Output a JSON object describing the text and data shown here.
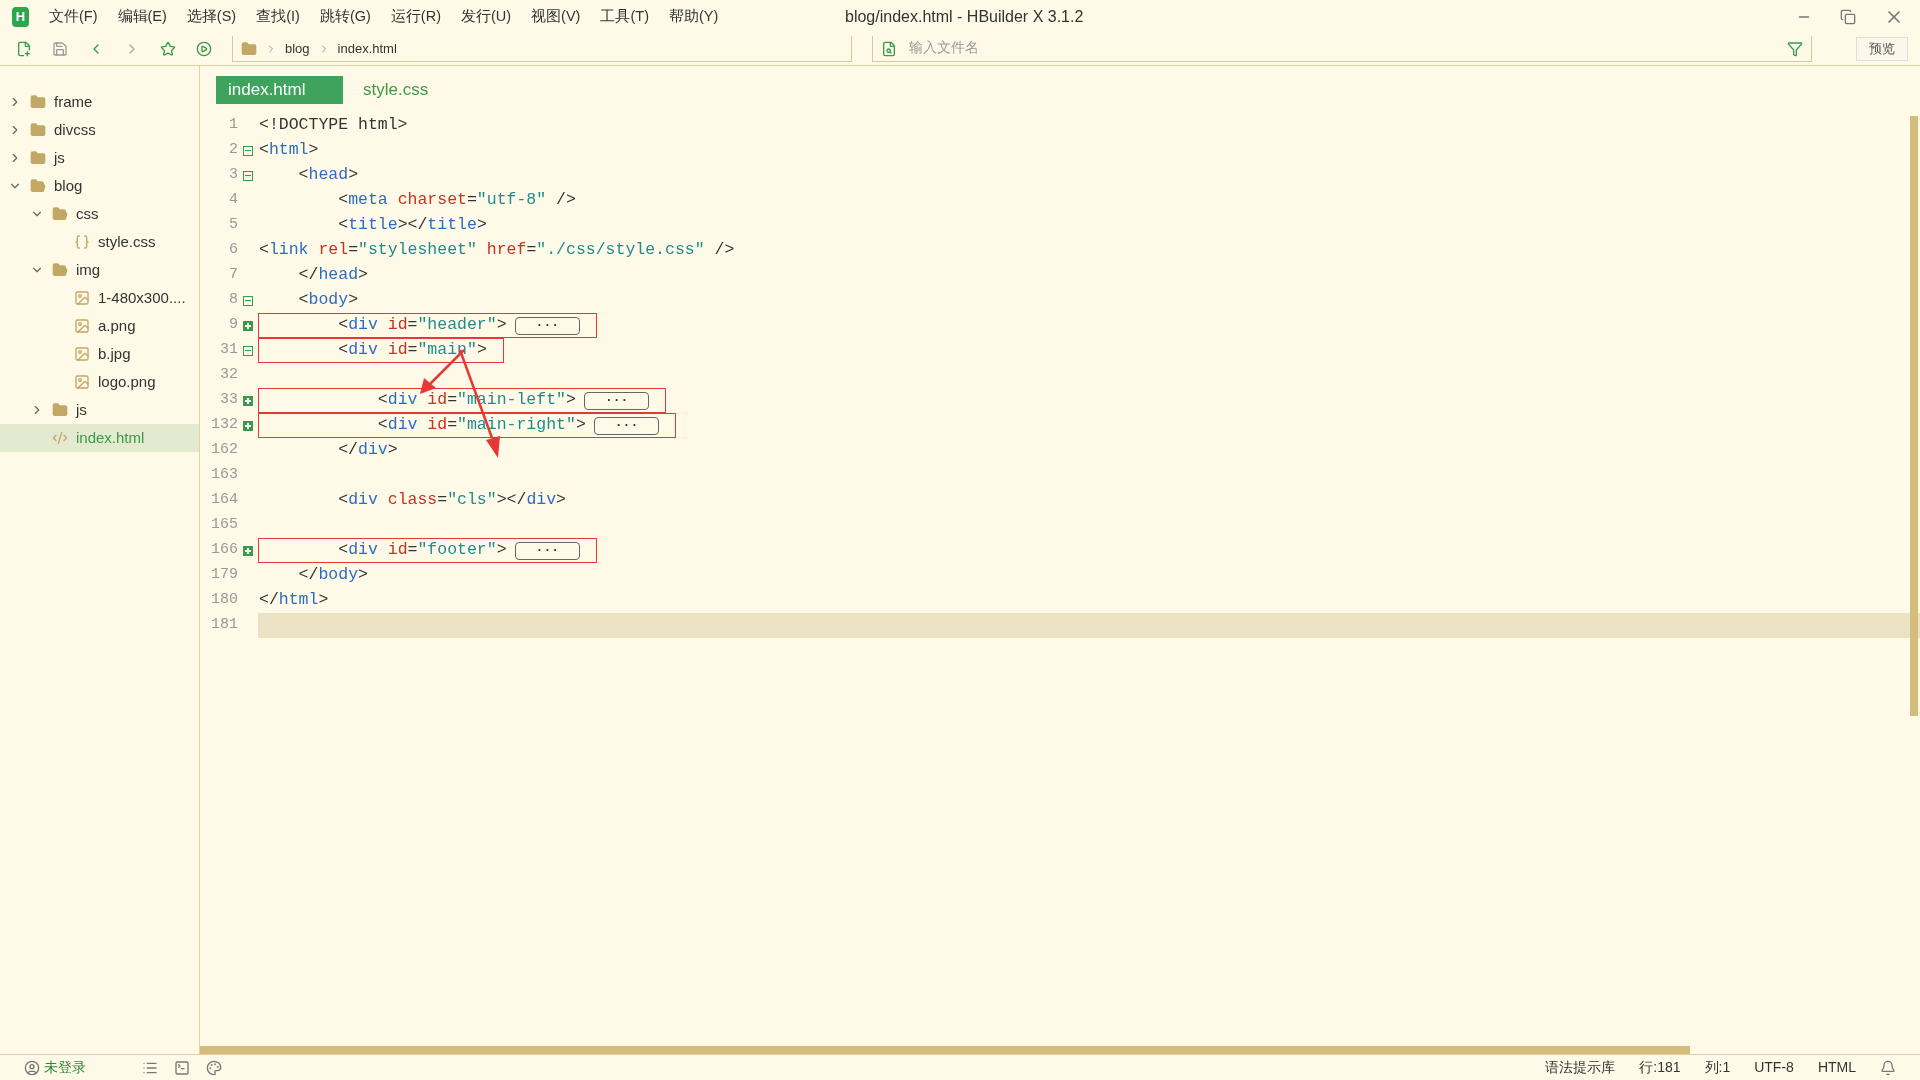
{
  "window": {
    "title": "blog/index.html - HBuilder X 3.1.2",
    "logo": "H"
  },
  "menu": [
    "文件(F)",
    "编辑(E)",
    "选择(S)",
    "查找(I)",
    "跳转(G)",
    "运行(R)",
    "发行(U)",
    "视图(V)",
    "工具(T)",
    "帮助(Y)"
  ],
  "toolbar": {
    "breadcrumb": [
      "blog",
      "index.html"
    ],
    "search": {
      "placeholder": "输入文件名"
    },
    "preview_button": "预览"
  },
  "sidebar": {
    "items": [
      {
        "name": "frame",
        "kind": "folder",
        "expanded": false,
        "selected": false
      },
      {
        "name": "divcss",
        "kind": "folder",
        "expanded": false,
        "selected": false
      },
      {
        "name": "js",
        "kind": "folder",
        "expanded": false,
        "selected": false
      },
      {
        "name": "blog",
        "kind": "folder",
        "expanded": true,
        "selected": false,
        "children": [
          {
            "name": "css",
            "kind": "folder",
            "expanded": true,
            "selected": false,
            "children": [
              {
                "name": "style.css",
                "kind": "css",
                "selected": false
              }
            ]
          },
          {
            "name": "img",
            "kind": "folder",
            "expanded": true,
            "selected": false,
            "children": [
              {
                "name": "1-480x300....",
                "kind": "image",
                "selected": false
              },
              {
                "name": "a.png",
                "kind": "image",
                "selected": false
              },
              {
                "name": "b.jpg",
                "kind": "image",
                "selected": false
              },
              {
                "name": "logo.png",
                "kind": "image",
                "selected": false
              }
            ]
          },
          {
            "name": "js",
            "kind": "folder",
            "expanded": false,
            "selected": false
          },
          {
            "name": "index.html",
            "kind": "html",
            "selected": true
          }
        ]
      }
    ]
  },
  "tabs": [
    {
      "label": "index.html",
      "selected": true
    },
    {
      "label": "style.css",
      "selected": false
    }
  ],
  "editor": {
    "lines": [
      {
        "number": "1",
        "annotated": false,
        "current": false,
        "tokens": [
          {
            "kind": "punct",
            "text": "<!DOCTYPE html>"
          }
        ]
      },
      {
        "number": "2",
        "expanded": true,
        "annotated": false,
        "current": false,
        "tokens": [
          {
            "kind": "punct",
            "text": "<"
          },
          {
            "kind": "tag",
            "text": "html"
          },
          {
            "kind": "punct",
            "text": ">"
          }
        ]
      },
      {
        "number": "3",
        "expanded": true,
        "annotated": false,
        "current": false,
        "tokens": [
          {
            "kind": "punct",
            "text": "    <"
          },
          {
            "kind": "tag",
            "text": "head"
          },
          {
            "kind": "punct",
            "text": ">"
          }
        ]
      },
      {
        "number": "4",
        "annotated": false,
        "current": false,
        "tokens": [
          {
            "kind": "punct",
            "text": "        <"
          },
          {
            "kind": "tag",
            "text": "meta "
          },
          {
            "kind": "attr",
            "text": "charset"
          },
          {
            "kind": "punct",
            "text": "="
          },
          {
            "kind": "string",
            "text": "\"utf-8\""
          },
          {
            "kind": "punct",
            "text": " />"
          }
        ]
      },
      {
        "number": "5",
        "annotated": false,
        "current": false,
        "tokens": [
          {
            "kind": "punct",
            "text": "        <"
          },
          {
            "kind": "tag",
            "text": "title"
          },
          {
            "kind": "punct",
            "text": "></"
          },
          {
            "kind": "tag",
            "text": "title"
          },
          {
            "kind": "punct",
            "text": ">"
          }
        ]
      },
      {
        "number": "6",
        "annotated": false,
        "current": false,
        "tokens": [
          {
            "kind": "punct",
            "text": "<"
          },
          {
            "kind": "tag",
            "text": "link "
          },
          {
            "kind": "attr",
            "text": "rel"
          },
          {
            "kind": "punct",
            "text": "="
          },
          {
            "kind": "string",
            "text": "\"stylesheet\" "
          },
          {
            "kind": "attr",
            "text": "href"
          },
          {
            "kind": "punct",
            "text": "="
          },
          {
            "kind": "string",
            "text": "\"./css/style.css\""
          },
          {
            "kind": "punct",
            "text": " />"
          }
        ]
      },
      {
        "number": "7",
        "annotated": false,
        "current": false,
        "tokens": [
          {
            "kind": "punct",
            "text": "    </"
          },
          {
            "kind": "tag",
            "text": "head"
          },
          {
            "kind": "punct",
            "text": ">"
          }
        ]
      },
      {
        "number": "8",
        "expanded": true,
        "annotated": false,
        "current": false,
        "tokens": [
          {
            "kind": "punct",
            "text": "    <"
          },
          {
            "kind": "tag",
            "text": "body"
          },
          {
            "kind": "punct",
            "text": ">"
          }
        ]
      },
      {
        "number": "9",
        "expanded": false,
        "annotated": true,
        "current": false,
        "tokens": [
          {
            "kind": "punct",
            "text": "        <"
          },
          {
            "kind": "tag",
            "text": "div "
          },
          {
            "kind": "attr",
            "text": "id"
          },
          {
            "kind": "punct",
            "text": "="
          },
          {
            "kind": "string",
            "text": "\"header\""
          },
          {
            "kind": "punct",
            "text": ">"
          }
        ],
        "folded_text": "···"
      },
      {
        "number": "31",
        "expanded": true,
        "annotated": true,
        "current": false,
        "tokens": [
          {
            "kind": "punct",
            "text": "        <"
          },
          {
            "kind": "tag",
            "text": "div "
          },
          {
            "kind": "attr",
            "text": "id"
          },
          {
            "kind": "punct",
            "text": "="
          },
          {
            "kind": "string",
            "text": "\"main\""
          },
          {
            "kind": "punct",
            "text": ">"
          }
        ]
      },
      {
        "number": "32",
        "current": false
      },
      {
        "number": "33",
        "expanded": false,
        "annotated": true,
        "current": false,
        "tokens": [
          {
            "kind": "punct",
            "text": "            <"
          },
          {
            "kind": "tag",
            "text": "div "
          },
          {
            "kind": "attr",
            "text": "id"
          },
          {
            "kind": "punct",
            "text": "="
          },
          {
            "kind": "string",
            "text": "\"main-left\""
          },
          {
            "kind": "punct",
            "text": ">"
          }
        ],
        "folded_text": "···"
      },
      {
        "number": "132",
        "expanded": false,
        "annotated": true,
        "current": false,
        "tokens": [
          {
            "kind": "punct",
            "text": "            <"
          },
          {
            "kind": "tag",
            "text": "div "
          },
          {
            "kind": "attr",
            "text": "id"
          },
          {
            "kind": "punct",
            "text": "="
          },
          {
            "kind": "string",
            "text": "\"main-right\""
          },
          {
            "kind": "punct",
            "text": ">"
          }
        ],
        "folded_text": "···"
      },
      {
        "number": "162",
        "annotated": false,
        "current": false,
        "tokens": [
          {
            "kind": "punct",
            "text": "        </"
          },
          {
            "kind": "tag",
            "text": "div"
          },
          {
            "kind": "punct",
            "text": ">"
          }
        ]
      },
      {
        "number": "163",
        "current": false
      },
      {
        "number": "164",
        "annotated": false,
        "current": false,
        "tokens": [
          {
            "kind": "punct",
            "text": "        <"
          },
          {
            "kind": "tag",
            "text": "div "
          },
          {
            "kind": "attr",
            "text": "class"
          },
          {
            "kind": "punct",
            "text": "="
          },
          {
            "kind": "string",
            "text": "\"cls\""
          },
          {
            "kind": "punct",
            "text": "></"
          },
          {
            "kind": "tag",
            "text": "div"
          },
          {
            "kind": "punct",
            "text": ">"
          }
        ]
      },
      {
        "number": "165",
        "current": false
      },
      {
        "number": "166",
        "expanded": false,
        "annotated": true,
        "current": false,
        "tokens": [
          {
            "kind": "punct",
            "text": "        <"
          },
          {
            "kind": "tag",
            "text": "div "
          },
          {
            "kind": "attr",
            "text": "id"
          },
          {
            "kind": "punct",
            "text": "="
          },
          {
            "kind": "string",
            "text": "\"footer\""
          },
          {
            "kind": "punct",
            "text": ">"
          }
        ],
        "folded_text": "···"
      },
      {
        "number": "179",
        "annotated": false,
        "current": false,
        "tokens": [
          {
            "kind": "punct",
            "text": "    </"
          },
          {
            "kind": "tag",
            "text": "body"
          },
          {
            "kind": "punct",
            "text": ">"
          }
        ]
      },
      {
        "number": "180",
        "annotated": false,
        "current": false,
        "tokens": [
          {
            "kind": "punct",
            "text": "</"
          },
          {
            "kind": "tag",
            "text": "html"
          },
          {
            "kind": "punct",
            "text": ">"
          }
        ]
      },
      {
        "number": "181",
        "current": true
      }
    ]
  },
  "status_bar": {
    "login": "未登录",
    "items": [
      "语法提示库",
      "行:181",
      "列:1",
      "UTF-8",
      "HTML"
    ]
  }
}
